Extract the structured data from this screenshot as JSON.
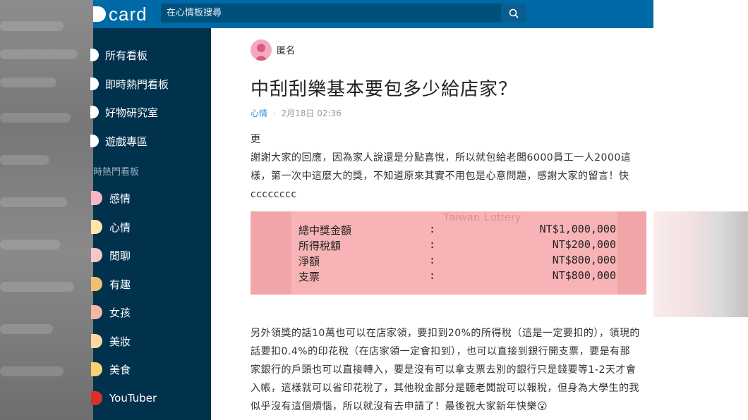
{
  "header": {
    "logo_text": "card",
    "search_placeholder": "在心情板搜尋"
  },
  "sidebar": {
    "main_items": [
      {
        "label": "所有看板"
      },
      {
        "label": "即時熱門看板"
      },
      {
        "label": "好物研究室"
      },
      {
        "label": "遊戲專區"
      }
    ],
    "section_heading": "時熱門看板",
    "boards": [
      {
        "label": "感情",
        "color": "#f7b7c4"
      },
      {
        "label": "心情",
        "color": "#ffe6a8"
      },
      {
        "label": "閒聊",
        "color": "#f6c7c7"
      },
      {
        "label": "有趣",
        "color": "#f0c070"
      },
      {
        "label": "女孩",
        "color": "#f3b7a3"
      },
      {
        "label": "美妝",
        "color": "#fbd9a0"
      },
      {
        "label": "美食",
        "color": "#f6d36f"
      },
      {
        "label": "YouTuber",
        "color": "#d9302c"
      }
    ]
  },
  "post": {
    "author": "匿名",
    "title": "中刮刮樂基本要包多少給店家？",
    "forum": "心情",
    "separator": "·",
    "timestamp": "2月18日 02:36",
    "paragraph1": [
      "更",
      "謝謝大家的回應，因為家人說還是分點喜悅，所以就包給老闆6000員工一人2000這",
      "樣，第一次中這麼大的獎，不知道原來其實不用包是心意問題，感謝大家的留言！快",
      "cccccccc"
    ],
    "ticket": {
      "brand": "Taiwan Lottery",
      "rows": [
        {
          "key": "總中獎金額",
          "colon": ":",
          "value": "NT$1,000,000"
        },
        {
          "key": "所得稅額",
          "colon": ":",
          "value": "NT$200,000"
        },
        {
          "key": "淨額",
          "colon": ":",
          "value": "NT$800,000"
        },
        {
          "key": "支票",
          "colon": ":",
          "value": "NT$800,000"
        }
      ]
    },
    "paragraph2": [
      "另外領獎的話10萬也可以在店家領，要扣到20%的所得稅（這是一定要扣的），領現的",
      "話要扣0.4%的印花稅（在店家領一定會扣到），也可以直接到銀行開支票，要是有那",
      "家銀行的戶頭也可以直接轉入，要是沒有可以拿支票去別的銀行只是錢要等1-2天才會",
      "入帳，這樣就可以省印花稅了，其他稅金部分是聽老闆說可以報稅，但身為大學生的我",
      "似乎沒有這個煩惱，所以就沒有去申請了！最後祝大家新年快樂😮"
    ]
  }
}
